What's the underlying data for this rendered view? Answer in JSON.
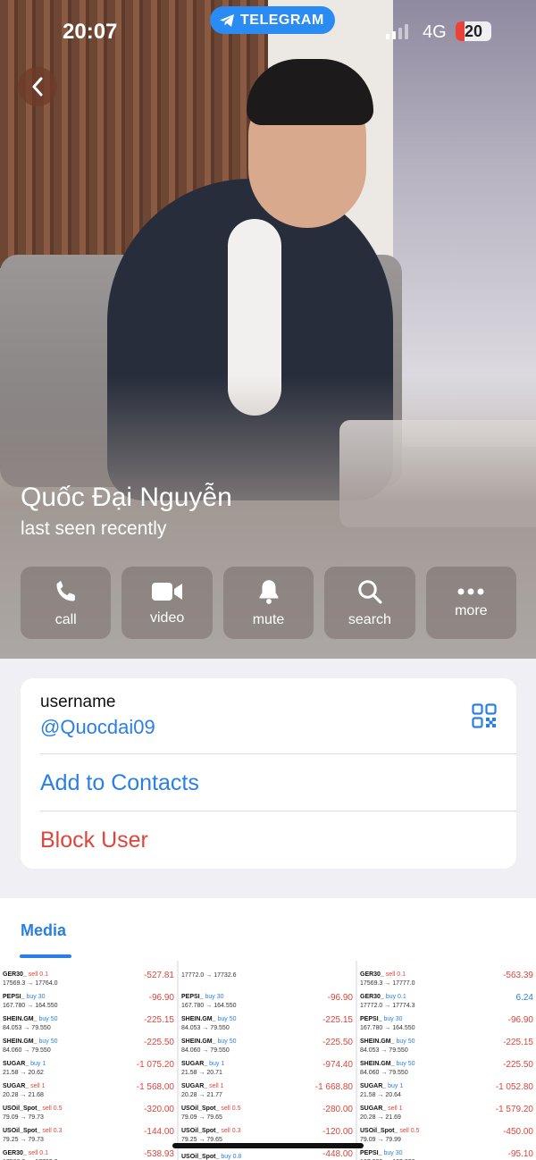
{
  "status_bar": {
    "time": "20:07",
    "app_pill": "TELEGRAM",
    "network": "4G",
    "battery": "20"
  },
  "profile": {
    "name": "Quốc Đại Nguyễn",
    "status": "last seen recently"
  },
  "actions": [
    {
      "icon": "phone-icon",
      "label": "call"
    },
    {
      "icon": "video-camera-icon",
      "label": "video"
    },
    {
      "icon": "bell-icon",
      "label": "mute"
    },
    {
      "icon": "search-icon",
      "label": "search"
    },
    {
      "icon": "more-dots-icon",
      "label": "more"
    }
  ],
  "info": {
    "username_label": "username",
    "username_value": "@Quocdai09",
    "add_contacts": "Add to Contacts",
    "block_user": "Block User"
  },
  "media": {
    "tab": "Media"
  },
  "colors": {
    "accent": "#2a7fe6",
    "danger": "#e0443a",
    "telegram": "#2a8bf2"
  },
  "thumbnails": [
    [
      {
        "sym": "GER30_",
        "dir": "sell 0.1",
        "px": "17569.3 → 17764.0",
        "val": "-527.81"
      },
      {
        "sym": "PEPSI_",
        "dir": "buy 30",
        "px": "167.780 → 164.550",
        "val": "-96.90"
      },
      {
        "sym": "SHEIN.GM_",
        "dir": "buy 50",
        "px": "84.053 → 79.550",
        "val": "-225.15"
      },
      {
        "sym": "SHEIN.GM_",
        "dir": "buy 50",
        "px": "84.060 → 79.550",
        "val": "-225.50"
      },
      {
        "sym": "SUGAR_",
        "dir": "buy 1",
        "px": "21.58 → 20.62",
        "val": "-1 075.20"
      },
      {
        "sym": "SUGAR_",
        "dir": "sell 1",
        "px": "20.28 → 21.68",
        "val": "-1 568.00"
      },
      {
        "sym": "USOil_Spot_",
        "dir": "sell 0.5",
        "px": "79.09 → 79.73",
        "val": "-320.00"
      },
      {
        "sym": "USOil_Spot_",
        "dir": "sell 0.3",
        "px": "79.25 → 79.73",
        "val": "-144.00"
      },
      {
        "sym": "GER30_",
        "dir": "sell 0.1",
        "px": "17569.3 → 17768.0",
        "val": "-538.93"
      }
    ],
    [
      {
        "sym": "",
        "dir": "",
        "px": "17772.0 → 17732.6",
        "val": ""
      },
      {
        "sym": "PEPSI_",
        "dir": "buy 30",
        "px": "167.780 → 164.550",
        "val": "-96.90"
      },
      {
        "sym": "SHEIN.GM_",
        "dir": "buy 50",
        "px": "84.053 → 79.550",
        "val": "-225.15"
      },
      {
        "sym": "SHEIN.GM_",
        "dir": "buy 50",
        "px": "84.060 → 79.550",
        "val": "-225.50"
      },
      {
        "sym": "SUGAR_",
        "dir": "buy 1",
        "px": "21.58 → 20.71",
        "val": "-974.40"
      },
      {
        "sym": "SUGAR_",
        "dir": "sell 1",
        "px": "20.28 → 21.77",
        "val": "-1 668.80"
      },
      {
        "sym": "USOil_Spot_",
        "dir": "sell 0.5",
        "px": "79.09 → 79.65",
        "val": "-280.00"
      },
      {
        "sym": "USOil_Spot_",
        "dir": "sell 0.3",
        "px": "79.25 → 79.65",
        "val": "-120.00"
      },
      {
        "sym": "USOil_Spot_",
        "dir": "buy 0.8",
        "px": "",
        "val": "-448.00"
      }
    ],
    [
      {
        "sym": "GER30_",
        "dir": "sell 0.1",
        "px": "17569.3 → 17777.0",
        "val": "-563.39"
      },
      {
        "sym": "GER30_",
        "dir": "buy 0.1",
        "px": "17772.0 → 17774.3",
        "val": "6.24"
      },
      {
        "sym": "PEPSI_",
        "dir": "buy 30",
        "px": "167.780 → 164.550",
        "val": "-96.90"
      },
      {
        "sym": "SHEIN.GM_",
        "dir": "buy 50",
        "px": "84.053 → 79.550",
        "val": "-225.15"
      },
      {
        "sym": "SHEIN.GM_",
        "dir": "buy 50",
        "px": "84.060 → 79.550",
        "val": "-225.50"
      },
      {
        "sym": "SUGAR_",
        "dir": "buy 1",
        "px": "21.58 → 20.64",
        "val": "-1 052.80"
      },
      {
        "sym": "SUGAR_",
        "dir": "sell 1",
        "px": "20.28 → 21.69",
        "val": "-1 579.20"
      },
      {
        "sym": "USOil_Spot_",
        "dir": "sell 0.5",
        "px": "79.09 → 79.99",
        "val": "-450.00"
      },
      {
        "sym": "PEPSI_",
        "dir": "buy 30",
        "px": "167.000 → 163.830",
        "val": "-95.10"
      }
    ]
  ]
}
